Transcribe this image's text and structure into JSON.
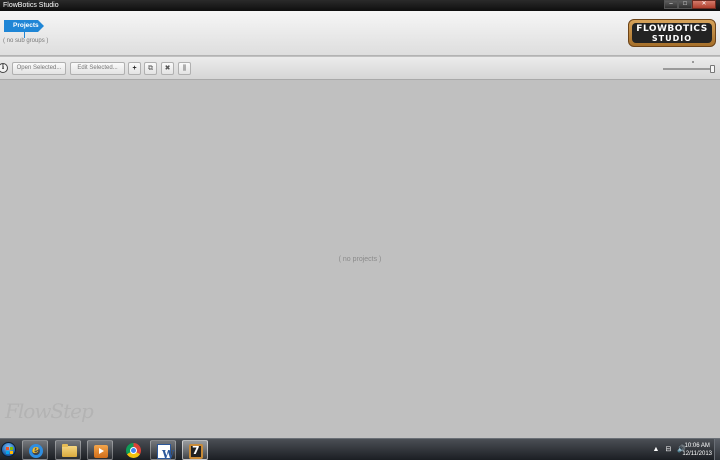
{
  "window": {
    "title": "FlowBotics Studio",
    "controls": {
      "minimize": "–",
      "maximize": "□",
      "close": "✕"
    }
  },
  "header": {
    "projects_tab": "Projects",
    "sub_groups_text": "( no sub groups )",
    "logo_line1": "FLOWBOTICS",
    "logo_line2": "STUDIO"
  },
  "toolbar": {
    "info_label": "i",
    "open_selected": "Open Selected...",
    "edit_selected": "Edit Selected...",
    "add_icon": "+",
    "duplicate_icon": "⧉",
    "delete_icon": "✖",
    "chart_icon": "⫼"
  },
  "main": {
    "empty_text": "( no projects )",
    "watermark": "FlowStep"
  },
  "taskbar": {
    "items": [
      "start-orb",
      "internet-explorer-icon",
      "file-explorer-icon",
      "media-player-icon",
      "chrome-icon",
      "word-icon",
      "flowbotics-icon"
    ],
    "word_letter": "W",
    "flowbotics_letter": "7",
    "tray_arrow": "▲",
    "tray_network": "⊟",
    "tray_volume": "🔊",
    "time": "10:06 AM",
    "date": "12/11/2013"
  },
  "colors": {
    "accent": "#1f86d6",
    "background": "#c0c0c0",
    "logo_frame": "#c98b37"
  }
}
